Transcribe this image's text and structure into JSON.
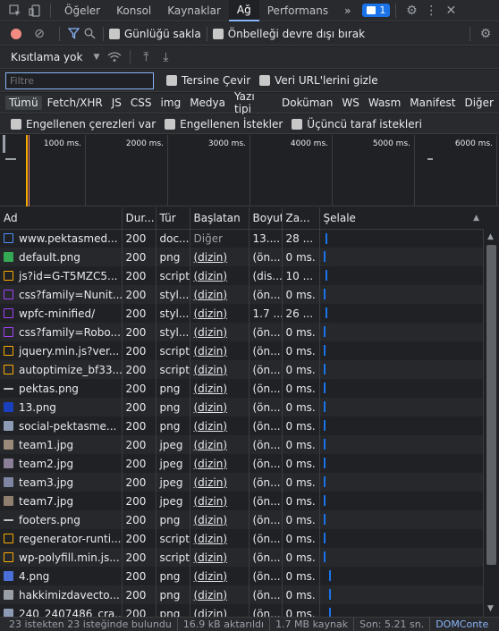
{
  "tabs": [
    "Öğeler",
    "Konsol",
    "Kaynaklar",
    "Ağ",
    "Performans"
  ],
  "active_tab": "Ağ",
  "more_tabs": "»",
  "issues_count": "1",
  "toolbar": {
    "preserve_log": "Günlüğü sakla",
    "disable_cache": "Önbelleği devre dışı bırak",
    "throttle": "Kısıtlama yok"
  },
  "filter": {
    "placeholder": "Filtre",
    "invert": "Tersine Çevir",
    "hide_data_urls": "Veri URL'lerini gizle"
  },
  "types": [
    "Tümü",
    "Fetch/XHR",
    "JS",
    "CSS",
    "img",
    "Medya",
    "Yazı tipi",
    "Doküman",
    "WS",
    "Wasm",
    "Manifest",
    "Diğer"
  ],
  "active_type": "Tümü",
  "blocked": {
    "cookies": "Engellenen çerezleri var",
    "requests": "Engellenen İstekler",
    "third_party": "Üçüncü taraf istekleri"
  },
  "timeline_ticks": [
    "1000 ms.",
    "2000 ms.",
    "3000 ms.",
    "4000 ms.",
    "5000 ms.",
    "6000 ms."
  ],
  "columns": [
    "Ad",
    "Dur...",
    "Tür",
    "Başlatan",
    "Boyut",
    "Za...",
    "Şelale"
  ],
  "rows": [
    {
      "name": "www.pektasmed...",
      "status": "200",
      "type": "doc...",
      "initiator": "Diğer",
      "size": "13....",
      "time": "28 ...",
      "icon": "document",
      "color": "#4e8ef7"
    },
    {
      "name": "default.png",
      "status": "200",
      "type": "png",
      "initiator": "(dizin)",
      "size": "(ön...",
      "time": "0 ms.",
      "icon": "image-green",
      "color": "#34a853"
    },
    {
      "name": "js?id=G-T5MZC5...",
      "status": "200",
      "type": "script",
      "initiator": "(dizin)",
      "size": "(dis...",
      "time": "10 ...",
      "icon": "script",
      "color": "#f9ab00"
    },
    {
      "name": "css?family=Nunit...",
      "status": "200",
      "type": "styl...",
      "initiator": "(dizin)",
      "size": "(ön...",
      "time": "0 ms.",
      "icon": "stylesheet",
      "color": "#a142f4"
    },
    {
      "name": "wpfc-minified/",
      "status": "200",
      "type": "styl...",
      "initiator": "(dizin)",
      "size": "1.7 ...",
      "time": "26 ...",
      "icon": "stylesheet",
      "color": "#a142f4"
    },
    {
      "name": "css?family=Robo...",
      "status": "200",
      "type": "styl...",
      "initiator": "(dizin)",
      "size": "(ön...",
      "time": "0 ms.",
      "icon": "stylesheet",
      "color": "#a142f4"
    },
    {
      "name": "jquery.min.js?ver...",
      "status": "200",
      "type": "script",
      "initiator": "(dizin)",
      "size": "(ön...",
      "time": "0 ms.",
      "icon": "script",
      "color": "#f9ab00"
    },
    {
      "name": "autoptimize_bf33...",
      "status": "200",
      "type": "script",
      "initiator": "(dizin)",
      "size": "(ön...",
      "time": "0 ms.",
      "icon": "script",
      "color": "#f9ab00"
    },
    {
      "name": "pektas.png",
      "status": "200",
      "type": "png",
      "initiator": "(dizin)",
      "size": "(ön...",
      "time": "0 ms.",
      "icon": "image-line",
      "color": "#bdc1c6"
    },
    {
      "name": "13.png",
      "status": "200",
      "type": "png",
      "initiator": "(dizin)",
      "size": "(ön...",
      "time": "0 ms.",
      "icon": "image-blue",
      "color": "#1a3fbf"
    },
    {
      "name": "social-pektasme...",
      "status": "200",
      "type": "png",
      "initiator": "(dizin)",
      "size": "(ön...",
      "time": "0 ms.",
      "icon": "image-grey",
      "color": "#8e9bb5"
    },
    {
      "name": "team1.jpg",
      "status": "200",
      "type": "jpeg",
      "initiator": "(dizin)",
      "size": "(ön...",
      "time": "0 ms.",
      "icon": "photo",
      "color": "#9b8a7a"
    },
    {
      "name": "team2.jpg",
      "status": "200",
      "type": "jpeg",
      "initiator": "(dizin)",
      "size": "(ön...",
      "time": "0 ms.",
      "icon": "photo",
      "color": "#8a7f96"
    },
    {
      "name": "team3.jpg",
      "status": "200",
      "type": "jpeg",
      "initiator": "(dizin)",
      "size": "(ön...",
      "time": "0 ms.",
      "icon": "photo",
      "color": "#7f86a3"
    },
    {
      "name": "team7.jpg",
      "status": "200",
      "type": "jpeg",
      "initiator": "(dizin)",
      "size": "(ön...",
      "time": "0 ms.",
      "icon": "photo",
      "color": "#8f7d6e"
    },
    {
      "name": "footers.png",
      "status": "200",
      "type": "png",
      "initiator": "(dizin)",
      "size": "(ön...",
      "time": "0 ms.",
      "icon": "image-line",
      "color": "#bdc1c6"
    },
    {
      "name": "regenerator-runti...",
      "status": "200",
      "type": "script",
      "initiator": "(dizin)",
      "size": "(ön...",
      "time": "0 ms.",
      "icon": "script",
      "color": "#f9ab00"
    },
    {
      "name": "wp-polyfill.min.js...",
      "status": "200",
      "type": "script",
      "initiator": "(dizin)",
      "size": "(ön...",
      "time": "0 ms.",
      "icon": "script",
      "color": "#f9ab00"
    },
    {
      "name": "4.png",
      "status": "200",
      "type": "png",
      "initiator": "(dizin)",
      "size": "(ön...",
      "time": "0 ms.",
      "icon": "image-blue",
      "color": "#4a6fd8"
    },
    {
      "name": "hakkimizdavecto...",
      "status": "200",
      "type": "png",
      "initiator": "(dizin)",
      "size": "(ön...",
      "time": "0 ms.",
      "icon": "image-grey",
      "color": "#9aa0a6"
    },
    {
      "name": "240_2407486_cra...",
      "status": "200",
      "type": "png",
      "initiator": "(dizin)",
      "size": "(ön...",
      "time": "0 ms.",
      "icon": "image-grey",
      "color": "#8e9bb5"
    }
  ],
  "status_bar": {
    "requests": "23 istekten 23 isteğinde bulundu",
    "transferred": "16.9 kB aktarıldı",
    "resources": "1.7 MB kaynak",
    "finish": "Son: 5.21 sn.",
    "dom": "DOMConte"
  }
}
